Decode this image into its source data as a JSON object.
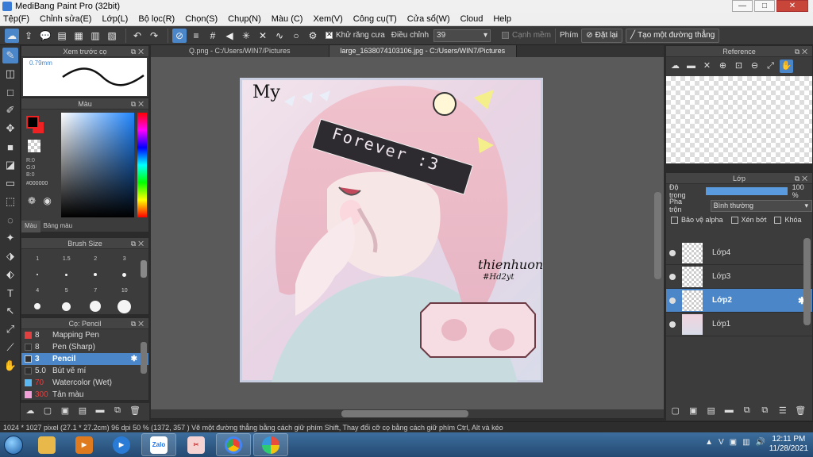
{
  "window": {
    "title": "MediBang Paint Pro (32bit)",
    "min": "—",
    "max": "□",
    "close": "✕"
  },
  "menu": [
    "Tệp(F)",
    "Chỉnh sửa(E)",
    "Lớp(L)",
    "Bộ lọc(R)",
    "Chọn(S)",
    "Chụp(N)",
    "Màu (C)",
    "Xem(V)",
    "Công cụ(T)",
    "Cửa sổ(W)",
    "Cloud",
    "Help"
  ],
  "toolbar": {
    "antialias_label": "Khử răng cưa",
    "adjust_label": "Điều chỉnh",
    "adjust_value": "39",
    "sharp_label": "Cạnh mềm",
    "key_label": "Phím",
    "reset_label": "Đặt lại",
    "straight_line_label": "Tạo một đường thẳng"
  },
  "brush_preview": {
    "title": "Xem trước cọ",
    "size": "0.79mm"
  },
  "color": {
    "title": "Màu",
    "fg": "#000000",
    "bg": "#e02020",
    "r": "R:0",
    "g": "G:0",
    "b": "B:0",
    "hex": "#000000",
    "tab_color": "Màu",
    "tab_palette": "Bảng màu"
  },
  "brush_size": {
    "title": "Brush Size",
    "labels": [
      "1",
      "1.5",
      "2",
      "3",
      "4",
      "5",
      "7",
      "10"
    ]
  },
  "brushes": {
    "title": "Cọ: Pencil",
    "items": [
      {
        "size": "8",
        "name": "Mapping Pen",
        "color": "#e04040"
      },
      {
        "size": "8",
        "name": "Pen (Sharp)",
        "color": "#303030"
      },
      {
        "size": "3",
        "name": "Pencil",
        "color": "#303030"
      },
      {
        "size": "5.0",
        "name": "Bút vẽ mí",
        "color": "#303030"
      },
      {
        "size": "70",
        "name": "Watercolor (Wet)",
        "color": "#5bb8f0"
      },
      {
        "size": "300",
        "name": "Tản màu",
        "color": "#f2a0d8"
      }
    ]
  },
  "documents": {
    "tabs": [
      "Q.png - C:/Users/WIN7/Pictures",
      "large_1638074103106.jpg - C:/Users/WIN7/Pictures"
    ]
  },
  "artwork": {
    "text_my": "My",
    "text_forever": "Forever :3",
    "signature": "thienhuong",
    "signature_tag": "#Hd2yt"
  },
  "reference": {
    "title": "Reference"
  },
  "layers": {
    "title": "Lớp",
    "opacity_label": "Độ trong",
    "opacity_value": "100 %",
    "opacity_fraction": 1.0,
    "blend_label": "Pha trộn",
    "blend_value": "Bình thường",
    "protect_alpha": "Bảo vệ alpha",
    "clipping": "Xén bớt",
    "lock": "Khóa",
    "items": [
      "Lớp4",
      "Lớp3",
      "Lớp2",
      "Lớp1"
    ]
  },
  "status": {
    "text": "1024 * 1027 pixel   (27.1 * 27.2cm)   96 dpi   50 %   (1372, 357 )   Vẽ một đường thẳng bằng cách giữ phím Shift, Thay đổi cỡ cọ bằng cách giữ phím Ctrl, Alt và kéo"
  },
  "taskbar": {
    "zalo": "Zalo",
    "time": "12:11 PM",
    "date": "11/28/2021"
  }
}
